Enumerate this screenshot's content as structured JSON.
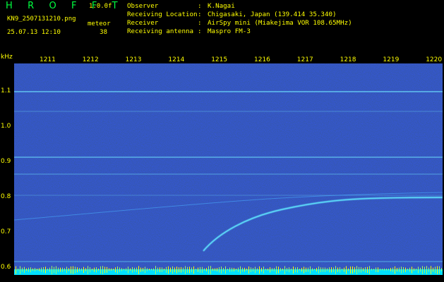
{
  "header": {
    "logo": "H R O F F T",
    "version": "1.0.0f",
    "filename": "KN9_2507131210.png",
    "datetime": "25.07.13 12:10",
    "meteor_label": "meteor",
    "meteor_count": "38",
    "observer_label": "Observer",
    "observer_value": "K.Nagai",
    "location_label": "Receiving Location",
    "location_value": "Chigasaki, Japan (139.414 35.340)",
    "receiver_label": "Receiver",
    "receiver_value": "AirSpy mini (Miakejima VOR 108.65MHz)",
    "antenna_label": "Receiving antenna",
    "antenna_value": "Maspro FM-3",
    "separator": ":"
  },
  "axes": {
    "y_unit": "kHz",
    "y_ticks": [
      "1.1",
      "1.0",
      "0.9",
      "0.8",
      "0.7",
      "0.6"
    ],
    "x_ticks": [
      "1211",
      "1212",
      "1213",
      "1214",
      "1215",
      "1216",
      "1217",
      "1218",
      "1219",
      "1220"
    ]
  },
  "colors": {
    "background": "#0a1a9a",
    "text": "#ffff00",
    "logo": "#00ff40",
    "trace": "#50e0ff",
    "baseline": "#00e0ff"
  }
}
